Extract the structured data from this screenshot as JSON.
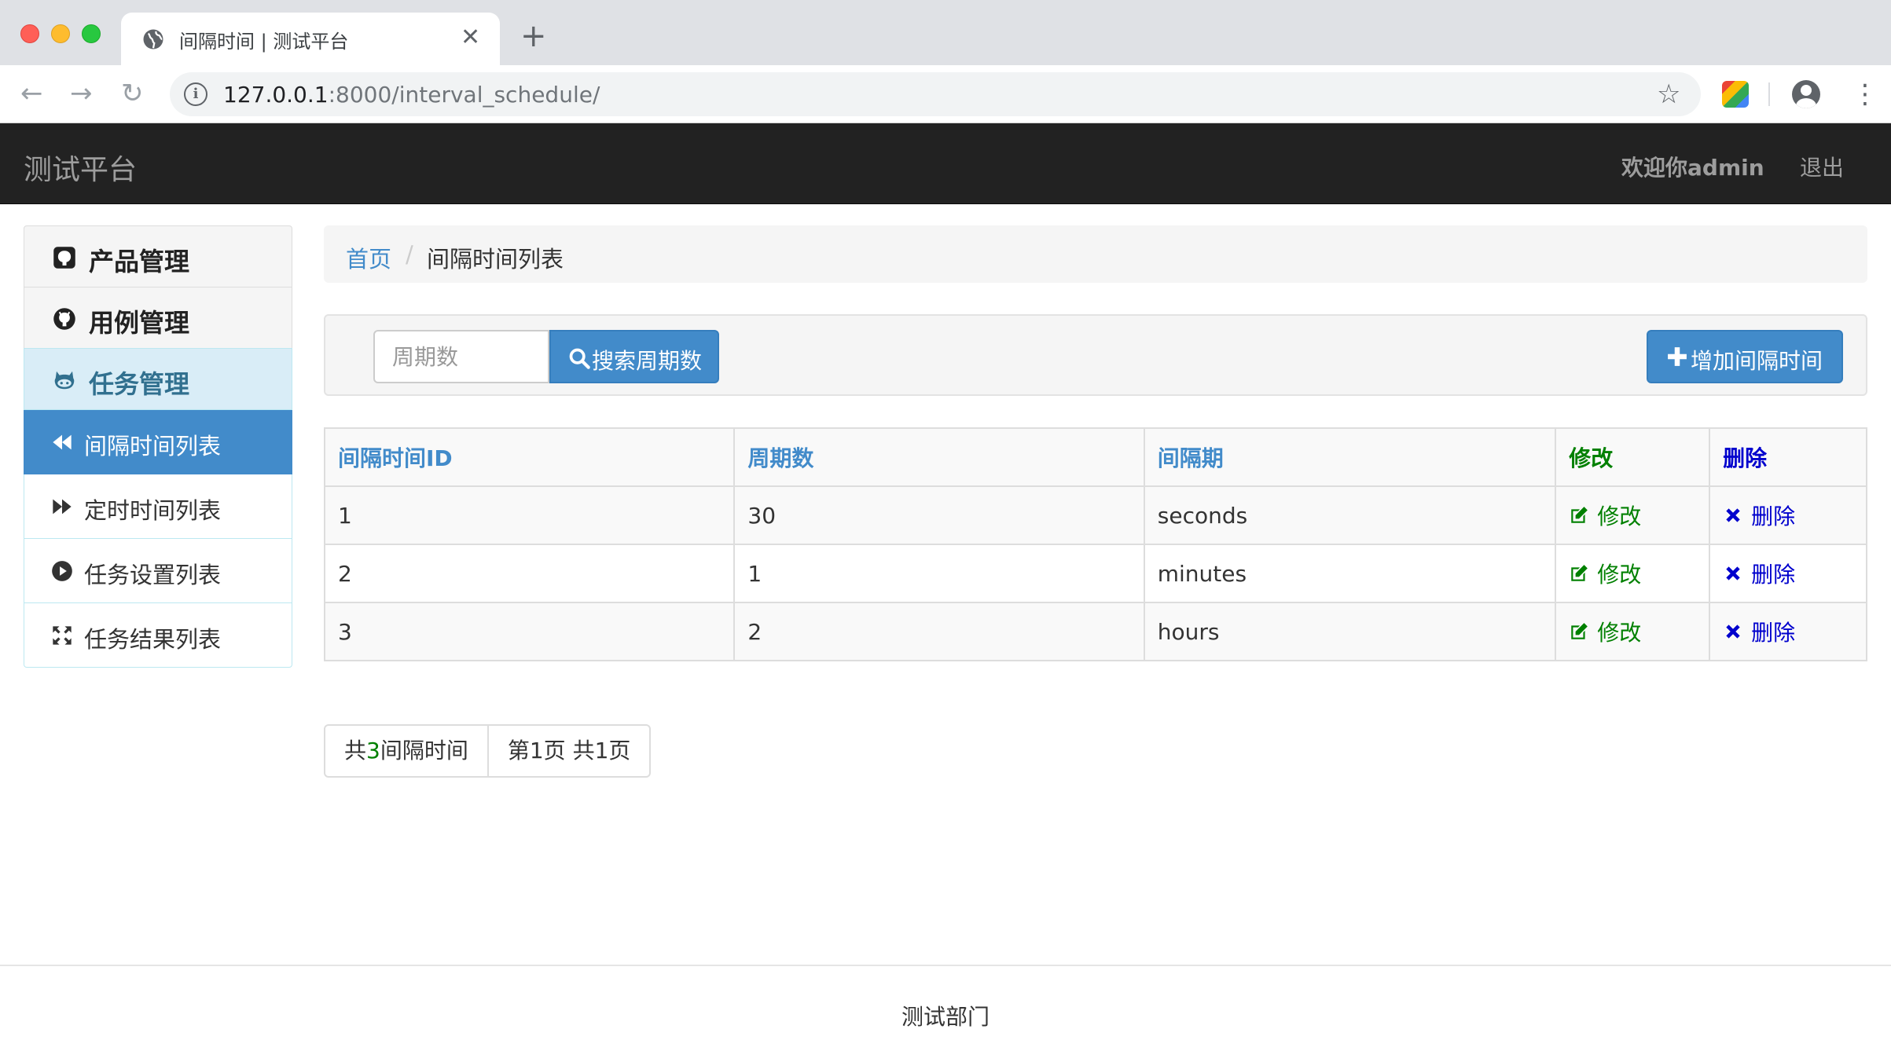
{
  "browser": {
    "tab_title": "间隔时间 | 测试平台",
    "url_host": "127.0.0.1",
    "url_rest": ":8000/interval_schedule/",
    "tab_icon": "globe-icon"
  },
  "navbar": {
    "brand": "测试平台",
    "welcome": "欢迎你admin",
    "logout": "退出"
  },
  "sidebar": {
    "sections": [
      {
        "label": "产品管理",
        "icon": "github-square-icon"
      },
      {
        "label": "用例管理",
        "icon": "github-icon"
      },
      {
        "label": "任务管理",
        "icon": "github-alt-icon"
      }
    ],
    "sub_items": [
      {
        "label": "间隔时间列表",
        "icon": "backward-icon",
        "active": true
      },
      {
        "label": "定时时间列表",
        "icon": "forward-icon"
      },
      {
        "label": "任务设置列表",
        "icon": "play-circle-icon"
      },
      {
        "label": "任务结果列表",
        "icon": "expand-icon"
      }
    ]
  },
  "breadcrumb": {
    "home": "首页",
    "separator": "/",
    "current": "间隔时间列表"
  },
  "search": {
    "placeholder": "周期数",
    "value": "",
    "button_label": "搜索周期数",
    "add_button_label": "增加间隔时间"
  },
  "table": {
    "headers": [
      "间隔时间ID",
      "周期数",
      "间隔期",
      "修改",
      "删除"
    ],
    "rows": [
      {
        "id": "1",
        "every": "30",
        "period": "seconds",
        "edit": "修改",
        "delete": "删除"
      },
      {
        "id": "2",
        "every": "1",
        "period": "minutes",
        "edit": "修改",
        "delete": "删除"
      },
      {
        "id": "3",
        "every": "2",
        "period": "hours",
        "edit": "修改",
        "delete": "删除"
      }
    ]
  },
  "pagination": {
    "total_prefix": "共",
    "total_count": "3",
    "total_suffix": "间隔时间",
    "page_info": "第1页 共1页"
  },
  "footer": {
    "text": "测试部门"
  },
  "colors": {
    "navbar_bg": "#222222",
    "primary": "#428bca",
    "edit_green": "#008000",
    "delete_blue": "#0000cd",
    "section_active_bg": "#d9edf7"
  }
}
